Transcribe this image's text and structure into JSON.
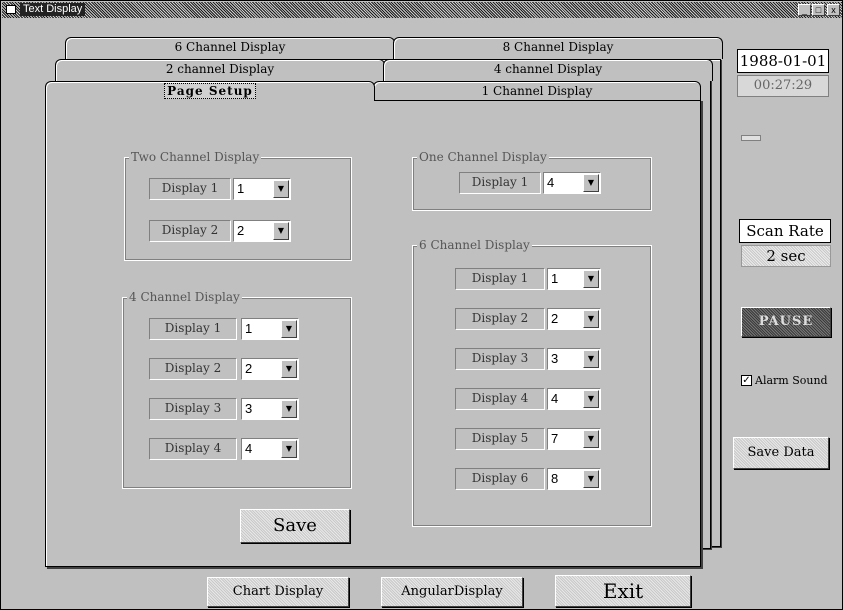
{
  "window": {
    "title": "Text Display",
    "min": "_",
    "max": "□",
    "close": "x"
  },
  "tabs": {
    "six_channel": "6 Channel Display",
    "eight_channel": "8 Channel Display",
    "two_channel": "2 channel Display",
    "four_channel": "4 channel Display",
    "page_setup": "Page Setup",
    "one_channel": "1 Channel Display"
  },
  "groups": {
    "two_channel": {
      "legend": "Two Channel Display",
      "rows": [
        {
          "label": "Display 1",
          "value": "1"
        },
        {
          "label": "Display 2",
          "value": "2"
        }
      ]
    },
    "one_channel": {
      "legend": "One Channel Display",
      "rows": [
        {
          "label": "Display 1",
          "value": "4"
        }
      ]
    },
    "four_channel": {
      "legend": "4 Channel Display",
      "rows": [
        {
          "label": "Display 1",
          "value": "1"
        },
        {
          "label": "Display 2",
          "value": "2"
        },
        {
          "label": "Display 3",
          "value": "3"
        },
        {
          "label": "Display 4",
          "value": "4"
        }
      ]
    },
    "six_channel": {
      "legend": "6 Channel Display",
      "rows": [
        {
          "label": "Display 1",
          "value": "1"
        },
        {
          "label": "Display 2",
          "value": "2"
        },
        {
          "label": "Display 3",
          "value": "3"
        },
        {
          "label": "Display 4",
          "value": "4"
        },
        {
          "label": "Display 5",
          "value": "7"
        },
        {
          "label": "Display 6",
          "value": "8"
        }
      ]
    }
  },
  "buttons": {
    "save": "Save",
    "chart_display": "Chart Display",
    "angular_display": "AngularDisplay",
    "exit": "Exit",
    "pause": "PAUSE",
    "save_data": "Save Data"
  },
  "side": {
    "date": "1988-01-01",
    "time": "00:27:29",
    "scan_rate_label": "Scan Rate",
    "scan_rate_value": "2 sec",
    "alarm_sound_label": "Alarm Sound",
    "alarm_sound_checked": true,
    "alarm_check_mark": "✓"
  },
  "colors": {
    "face": "#c0c0c0",
    "shadow": "#808080",
    "highlight": "#ffffff"
  }
}
